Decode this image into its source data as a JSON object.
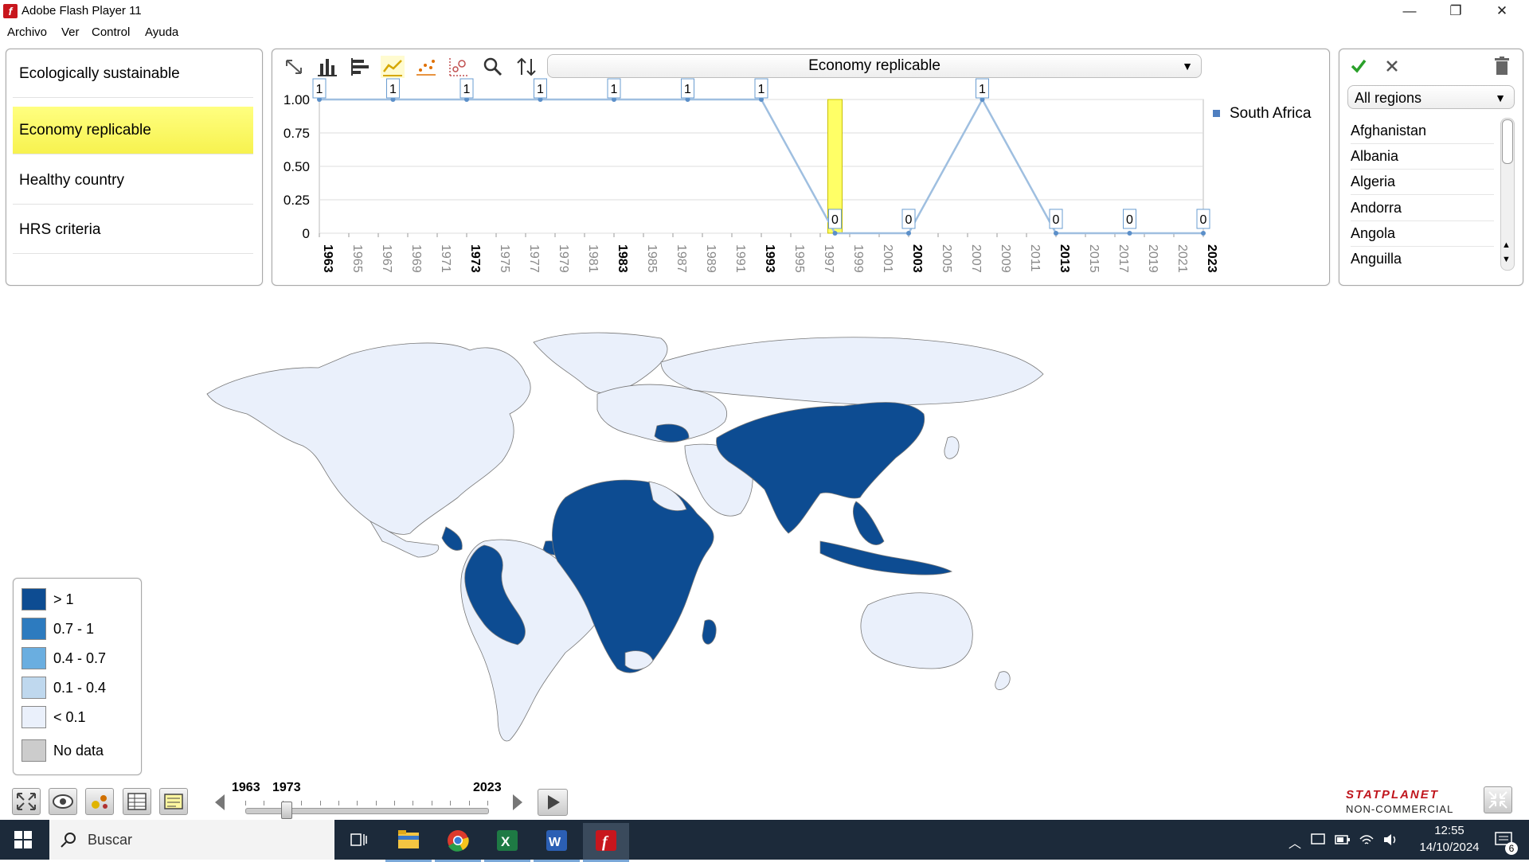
{
  "window": {
    "title": "Adobe Flash Player 11",
    "minimize_glyph": "—",
    "restore_glyph": "❐",
    "close_glyph": "✕"
  },
  "menu": [
    "Archivo",
    "Ver",
    "Control",
    "Ayuda"
  ],
  "indicators": [
    {
      "label": "Ecologically sustainable",
      "selected": false
    },
    {
      "label": "Economy replicable",
      "selected": true
    },
    {
      "label": "Healthy country",
      "selected": false
    },
    {
      "label": "HRS criteria",
      "selected": false
    }
  ],
  "chart_toolbar": {
    "icons": [
      "fullscreen-icon",
      "bar-chart-icon",
      "horizontal-bar-icon",
      "line-chart-icon",
      "scatter-icon",
      "bubble-icon",
      "zoom-icon",
      "sort-icon"
    ],
    "indicator_select": "Economy replicable"
  },
  "chart_data": {
    "type": "line",
    "series": [
      {
        "name": "South Africa",
        "color": "#9fbfe0",
        "x": [
          1963,
          1968,
          1973,
          1978,
          1983,
          1988,
          1993,
          1998,
          2003,
          2008,
          2013,
          2018,
          2023
        ],
        "values": [
          1,
          1,
          1,
          1,
          1,
          1,
          1,
          0,
          0,
          1,
          0,
          0,
          0
        ],
        "point_labels": [
          "1",
          "1",
          "1",
          "1",
          "1",
          "1",
          "1",
          "0",
          "0",
          "1",
          "0",
          "0",
          "0"
        ]
      }
    ],
    "highlight_year": 1998,
    "highlight_color": "#ffff66",
    "xlim": [
      1963,
      2023
    ],
    "ylim": [
      0,
      1
    ],
    "yticks": [
      "1.00",
      "0.75",
      "0.50",
      "0.25",
      "0"
    ],
    "ytick_values": [
      1,
      0.75,
      0.5,
      0.25,
      0
    ],
    "xticks": [
      "1963",
      "1965",
      "1967",
      "1969",
      "1971",
      "1973",
      "1975",
      "1977",
      "1979",
      "1981",
      "1983",
      "1985",
      "1987",
      "1989",
      "1991",
      "1993",
      "1995",
      "1997",
      "1999",
      "2001",
      "2003",
      "2005",
      "2007",
      "2009",
      "2011",
      "2013",
      "2015",
      "2017",
      "2019",
      "2021",
      "2023"
    ],
    "bold_xticks": [
      "1963",
      "1973",
      "1983",
      "1993",
      "2003",
      "2013",
      "2023"
    ],
    "grid": true,
    "legend_position": "right"
  },
  "regions": {
    "select_label": "All regions",
    "countries": [
      "Afghanistan",
      "Albania",
      "Algeria",
      "Andorra",
      "Angola",
      "Anguilla"
    ]
  },
  "legend": [
    {
      "label": "> 1",
      "color": "#0d4c92"
    },
    {
      "label": "0.7 - 1",
      "color": "#2d7bbf"
    },
    {
      "label": "0.4 - 0.7",
      "color": "#6aaee0"
    },
    {
      "label": "0.1 - 0.4",
      "color": "#bfd8ee"
    },
    {
      "label": "< 0.1",
      "color": "#eaf0fb"
    },
    {
      "label": "No data",
      "color": "#cccccc"
    }
  ],
  "timeline": {
    "start": "1963",
    "current": "1973",
    "end": "2023",
    "position": 0.1667
  },
  "brand": {
    "line1": "STATPLANET",
    "line2": "NON-COMMERCIAL"
  },
  "taskbar": {
    "search_placeholder": "Buscar",
    "time": "12:55",
    "date": "14/10/2024",
    "notifications": "6"
  }
}
